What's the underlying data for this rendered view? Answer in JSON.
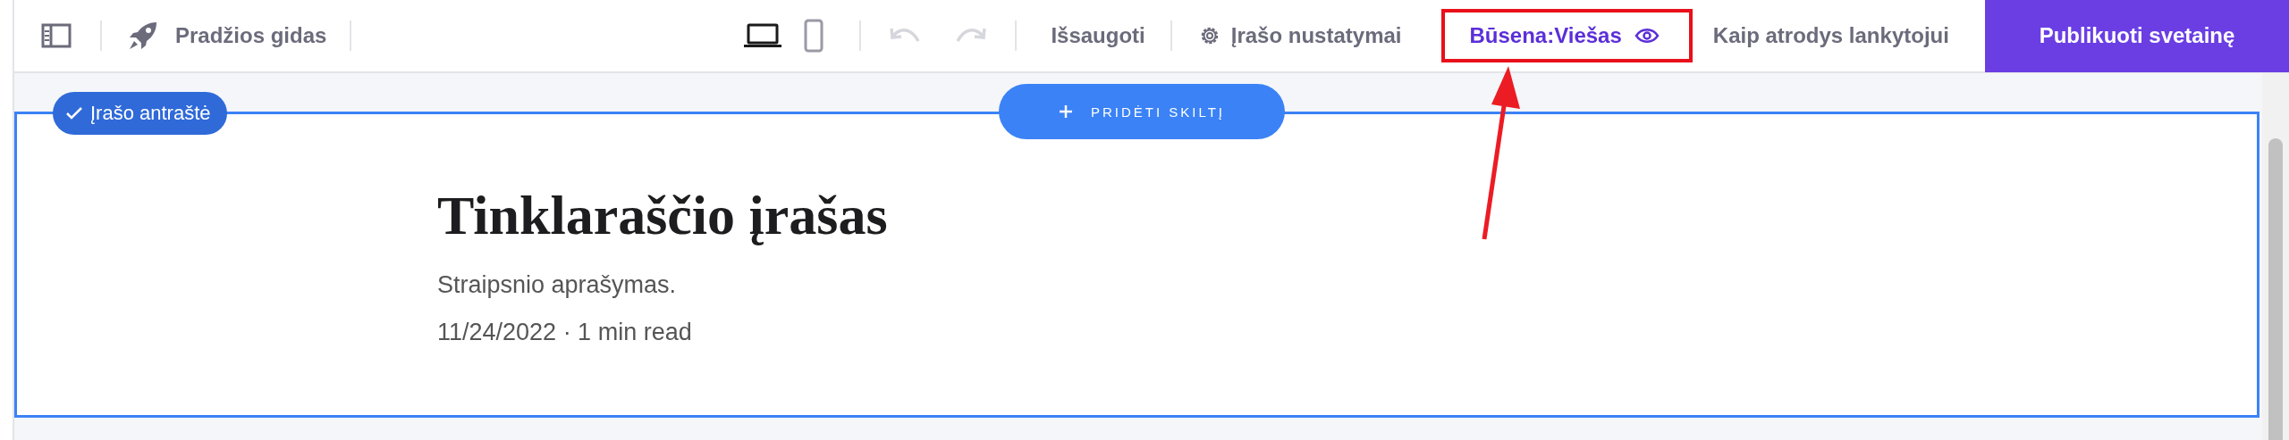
{
  "toolbar": {
    "guide": {
      "label": "Pradžios gidas"
    },
    "devices": [
      {
        "kind": "desktop",
        "selected": true
      },
      {
        "kind": "mobile",
        "selected": false
      }
    ],
    "history": [
      {
        "kind": "undo",
        "disabled": true
      },
      {
        "kind": "redo",
        "disabled": true
      }
    ],
    "save": {
      "label": "Išsaugoti"
    },
    "settings": {
      "label": "Įrašo nustatymai"
    },
    "status": {
      "label": "Būsena:Viešas",
      "highlighted": true
    },
    "preview": {
      "label": "Kaip atrodys lankytojui"
    },
    "publish": {
      "label": "Publikuoti svetainę"
    }
  },
  "section": {
    "badge": "Įrašo antraštė",
    "selected": true,
    "add_button": "PRIDĖTI SKILTĮ",
    "title": "Tinklaraščio įrašas",
    "description": "Straipsnio aprašymas.",
    "meta": "11/24/2022 · 1 min read"
  }
}
